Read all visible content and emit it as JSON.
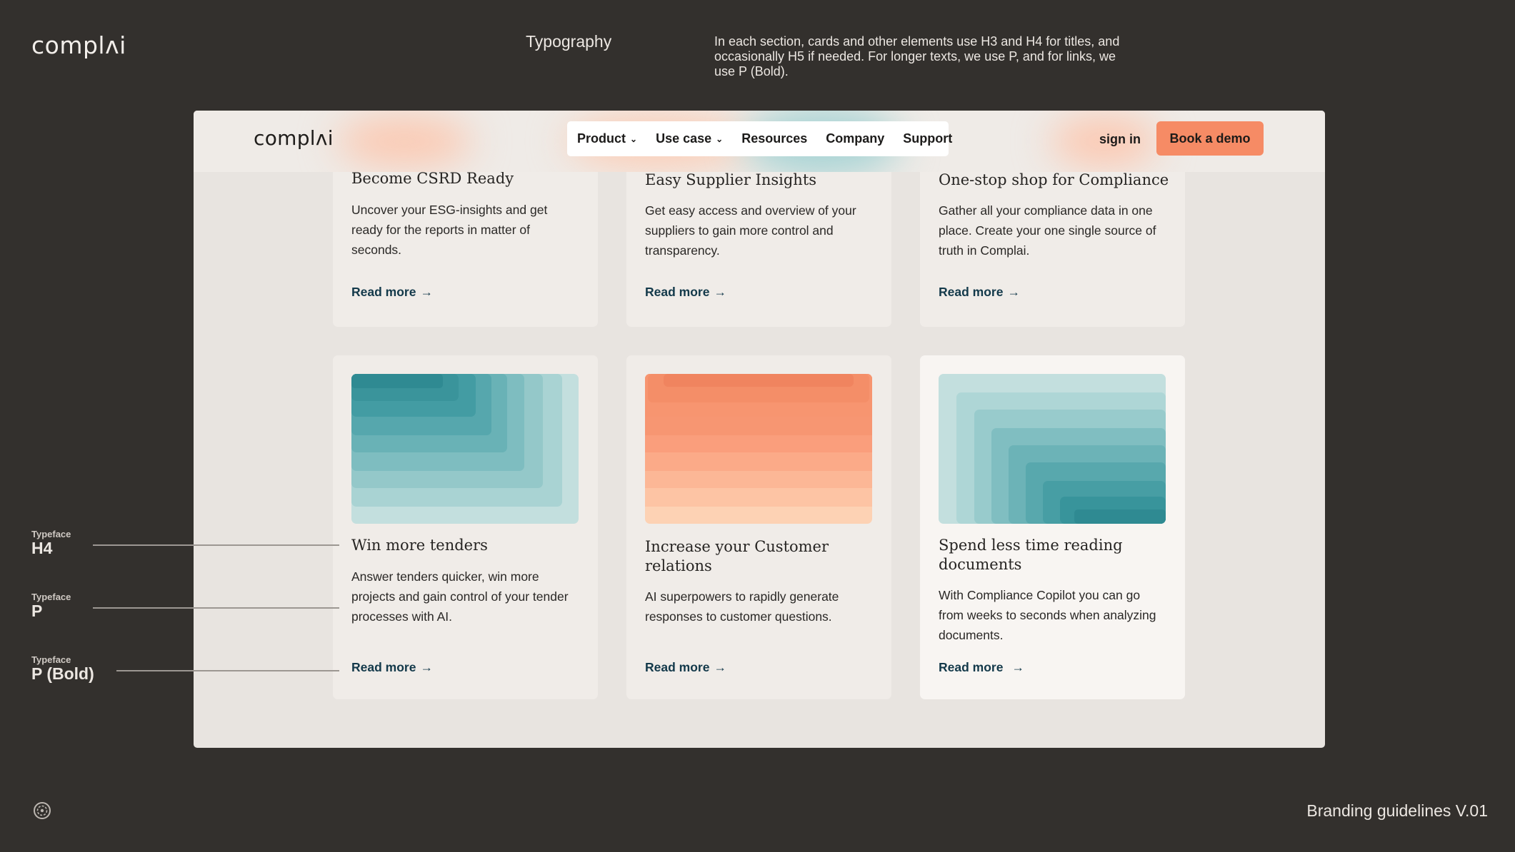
{
  "brand": {
    "logo_text": "complʌi"
  },
  "slide": {
    "title": "Typography",
    "description": "In each section, cards and other elements use H3 and H4 for titles, and occasionally H5 if needed. For longer texts, we use P, and for links, we use P (Bold)."
  },
  "nav": {
    "logo_text": "complʌi",
    "items": [
      {
        "label": "Product",
        "icon": "chevron-down-icon"
      },
      {
        "label": "Use case",
        "icon": "chevron-down-icon"
      },
      {
        "label": "Resources"
      },
      {
        "label": "Company"
      },
      {
        "label": "Support"
      }
    ],
    "sign_in": "sign in",
    "cta": "Book a demo"
  },
  "cards": [
    {
      "title": "Become CSRD Ready",
      "text": "Uncover your ESG-insights and get ready for the reports in matter of seconds.",
      "link": "Read more"
    },
    {
      "title": "Easy Supplier Insights",
      "text": "Get easy access and overview of your suppliers to gain more control and transparency.",
      "link": "Read more"
    },
    {
      "title": "One-stop shop for Compliance",
      "text": "Gather all your compliance data in one place. Create your one single source of truth in Complai.",
      "link": "Read more"
    },
    {
      "title": "Win more tenders",
      "text": "Answer tenders quicker, win more projects and gain control of your tender processes with AI.",
      "link": "Read more",
      "image": "teal-gradient-steps-top-left"
    },
    {
      "title": "Increase your Customer relations",
      "text": "AI superpowers to rapidly generate responses to customer questions.",
      "link": "Read more",
      "image": "peach-gradient-steps-top"
    },
    {
      "title": "Spend less time reading documents",
      "text": "With Compliance Copilot you can go from weeks to seconds when analyzing documents.",
      "link": "Read more",
      "image": "teal-gradient-steps-bottom-right"
    }
  ],
  "type_labels": [
    {
      "caption": "Typeface",
      "name": "H4"
    },
    {
      "caption": "Typeface",
      "name": "P"
    },
    {
      "caption": "Typeface",
      "name": "P (Bold)"
    }
  ],
  "footer": {
    "icon": "circle-logo-icon",
    "text": "Branding guidelines V.01"
  },
  "colors": {
    "background": "#33302d",
    "accent": "#f68b65",
    "link": "#13394a",
    "teal": "#2f8f94"
  }
}
